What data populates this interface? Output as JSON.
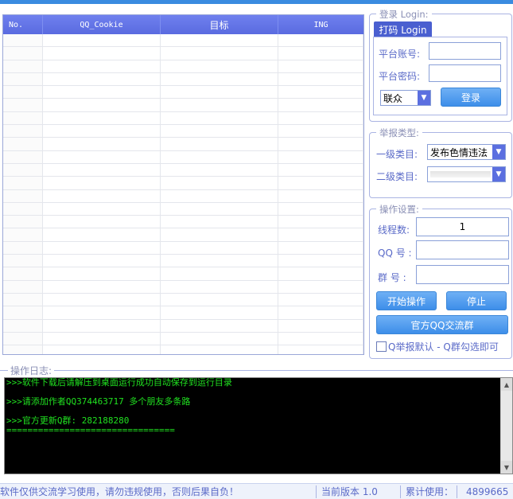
{
  "table": {
    "columns": [
      "No.",
      "QQ_Cookie",
      "目标",
      "ING"
    ],
    "row_count": 26
  },
  "login": {
    "legend": "登录 Login:",
    "tab_label": "打码 Login",
    "account_label": "平台账号:",
    "account_value": "",
    "password_label": "平台密码:",
    "password_value": "",
    "platform_select": "联众",
    "login_button": "登录"
  },
  "report": {
    "legend": "举报类型:",
    "level1_label": "一级类目:",
    "level1_value": "发布色情违法",
    "level2_label": "二级类目:",
    "level2_value": ""
  },
  "settings": {
    "legend": "操作设置:",
    "threads_label": "线程数:",
    "threads_value": "1",
    "qq_label": "QQ 号 :",
    "qq_value": "",
    "group_label": "群 号 :",
    "group_value": "",
    "start_button": "开始操作",
    "stop_button": "停止",
    "official_button": "官方QQ交流群",
    "checkbox_label": "Q举报默认 - Q群勾选即可"
  },
  "log": {
    "legend": "操作日志:",
    "lines": [
      ">>>软件下载后请解压到桌面运行成功自动保存到运行目录",
      "",
      ">>>请添加作者QQ374463717 多个朋友多条路",
      "",
      ">>>官方更新Q群: 282188280",
      "================================"
    ]
  },
  "status": {
    "notice": "软件仅供交流学习使用，请勿违规使用，否则后果自负！",
    "version": "当前版本 1.0",
    "usage_label": "累计使用：",
    "usage_count": "4899665"
  }
}
